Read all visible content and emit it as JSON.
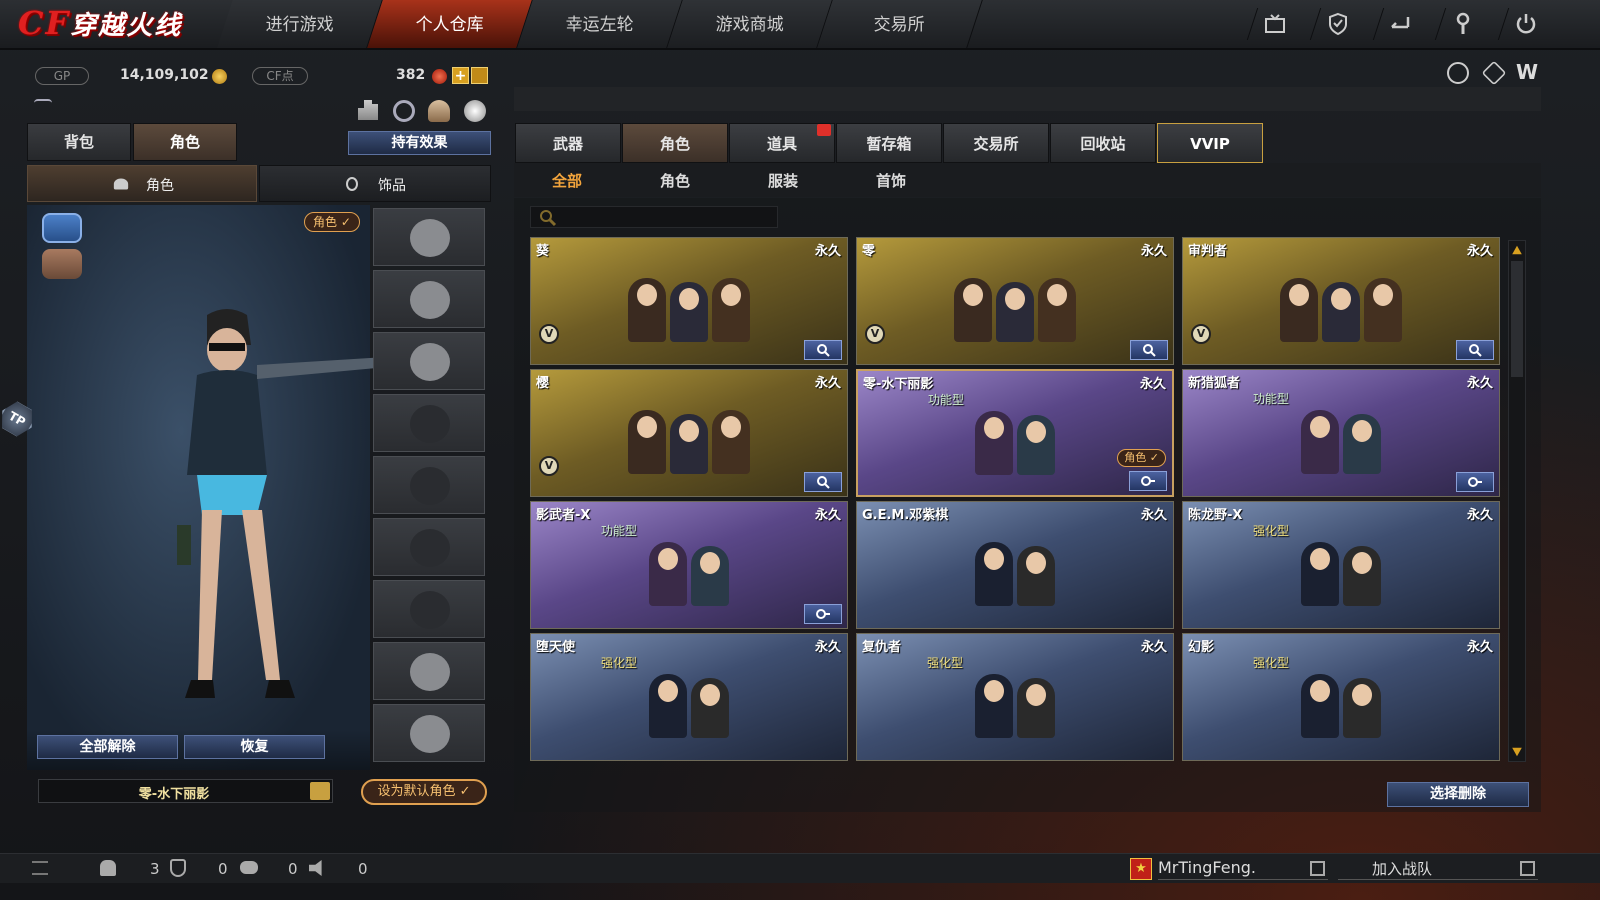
{
  "nav": {
    "logo_text": "穿越火线",
    "tabs": [
      "进行游戏",
      "个人仓库",
      "幸运左轮",
      "游戏商城",
      "交易所"
    ],
    "active_tab": 1,
    "right_icons": [
      "tv-icon",
      "shield-icon",
      "exit-icon",
      "wrench-icon",
      "power-icon"
    ]
  },
  "currency": {
    "gp_label": "GP",
    "gp_value": "14,109,102",
    "cf_label": "CF点",
    "cf_value": "382"
  },
  "left": {
    "tabs": [
      "背包",
      "角色"
    ],
    "active_tab": 1,
    "effect_button": "持有效果",
    "subtabs": [
      "角色",
      "饰品"
    ],
    "role_badge": "角色",
    "unequip_all": "全部解除",
    "restore": "恢复",
    "current_role": "零-水下丽影",
    "set_default": "设为默认角色"
  },
  "right": {
    "tabs": [
      "武器",
      "角色",
      "道具",
      "暂存箱",
      "交易所",
      "回收站",
      "VVIP"
    ],
    "active_tab": 1,
    "subtabs": [
      "全部",
      "角色",
      "服装",
      "首饰"
    ],
    "active_subtab": 0,
    "search_placeholder": "",
    "cards": [
      {
        "name": "葵",
        "duration": "永久",
        "type": "",
        "theme": "gold",
        "vip": true,
        "selected": false,
        "role_badge": "",
        "btn": "search"
      },
      {
        "name": "零",
        "duration": "永久",
        "type": "",
        "theme": "gold",
        "vip": true,
        "selected": false,
        "role_badge": "",
        "btn": "search"
      },
      {
        "name": "审判者",
        "duration": "永久",
        "type": "",
        "theme": "gold",
        "vip": true,
        "selected": false,
        "role_badge": "",
        "btn": "search"
      },
      {
        "name": "樱",
        "duration": "永久",
        "type": "",
        "theme": "gold",
        "vip": true,
        "selected": false,
        "role_badge": "",
        "btn": "search"
      },
      {
        "name": "零-水下丽影",
        "duration": "永久",
        "type": "功能型",
        "theme": "purple",
        "vip": false,
        "selected": true,
        "role_badge": "角色",
        "btn": "gear"
      },
      {
        "name": "新猎狐者",
        "duration": "永久",
        "type": "功能型",
        "theme": "purple",
        "vip": false,
        "selected": false,
        "role_badge": "",
        "btn": "gear"
      },
      {
        "name": "影武者-X",
        "duration": "永久",
        "type": "功能型",
        "theme": "purple",
        "vip": false,
        "selected": false,
        "role_badge": "",
        "btn": "gear"
      },
      {
        "name": "G.E.M.邓紫棋",
        "duration": "永久",
        "type": "",
        "theme": "blue",
        "vip": false,
        "selected": false,
        "role_badge": "",
        "btn": ""
      },
      {
        "name": "陈龙野-X",
        "duration": "永久",
        "type": "强化型",
        "theme": "blue",
        "vip": false,
        "selected": false,
        "role_badge": "",
        "btn": ""
      },
      {
        "name": "堕天使",
        "duration": "永久",
        "type": "强化型",
        "theme": "blue",
        "vip": false,
        "selected": false,
        "role_badge": "",
        "btn": ""
      },
      {
        "name": "复仇者",
        "duration": "永久",
        "type": "强化型",
        "theme": "blue",
        "vip": false,
        "selected": false,
        "role_badge": "",
        "btn": ""
      },
      {
        "name": "幻影",
        "duration": "永久",
        "type": "强化型",
        "theme": "blue",
        "vip": false,
        "selected": false,
        "role_badge": "",
        "btn": ""
      }
    ],
    "select_delete": "选择删除"
  },
  "bottom": {
    "counts": [
      "3",
      "0",
      "0",
      "0"
    ],
    "username": "MrTingFeng.",
    "join_team": "加入战队"
  }
}
